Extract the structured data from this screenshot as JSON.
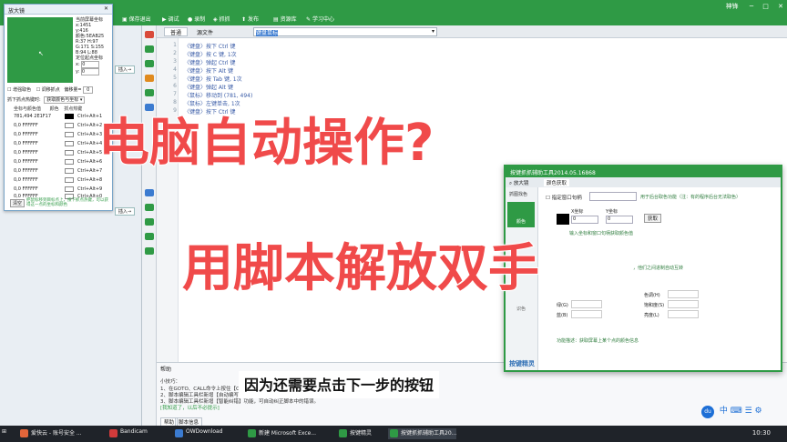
{
  "app": {
    "window_controls": "神锋",
    "toolbar": [
      {
        "label": "保存退出",
        "icon": "save-icon"
      },
      {
        "label": "调试",
        "icon": "debug-icon"
      },
      {
        "label": "录制",
        "icon": "record-icon"
      },
      {
        "label": "抓抓",
        "icon": "grab-icon"
      },
      {
        "label": "发布",
        "icon": "publish-icon"
      },
      {
        "label": "资源库",
        "icon": "library-icon"
      },
      {
        "label": "学习中心",
        "icon": "learn-icon"
      }
    ]
  },
  "editor": {
    "tab_label": "普通",
    "tab_source": "源文件",
    "input_value": "键盘鼠标",
    "lines": [
      "〈键盘〉按下 Ctrl 键",
      "〈键盘〉按 C 键, 1次",
      "〈键盘〉弹起 Ctrl 键",
      "〈键盘〉按下 Alt 键",
      "〈键盘〉按 Tab 键, 1次",
      "〈键盘〉弹起 Alt 键",
      "〈鼠标〉移动到 (781, 494)",
      "〈鼠标〉左键单击, 1次",
      "〈键盘〉按下 Ctrl 键"
    ]
  },
  "magnifier": {
    "title": "放大镜",
    "info": [
      "当前屏幕坐标",
      "x:1451",
      "y:416",
      "颜色:5EAB25",
      "R:37 H:97",
      "G:171 S:155",
      "B:94 L:88",
      "定位起点坐标",
      "x:",
      "y:"
    ],
    "x_value": "0",
    "y_value": "0",
    "options": [
      "增强取色",
      "调移抓点",
      "偏移量="
    ],
    "offset_value": "0",
    "hotkey_label": "抓下抓点热键时:",
    "hotkey_select": "获取颜色与坐标",
    "table_headers": [
      "坐标与颜色值",
      "颜色",
      "抓点热键"
    ],
    "rows": [
      {
        "coord": "781,494 2E1F17",
        "key": "Ctrl+Alt+1"
      },
      {
        "coord": "0,0 FFFFFF",
        "key": "Ctrl+Alt+2"
      },
      {
        "coord": "0,0 FFFFFF",
        "key": "Ctrl+Alt+3"
      },
      {
        "coord": "0,0 FFFFFF",
        "key": "Ctrl+Alt+4"
      },
      {
        "coord": "0,0 FFFFFF",
        "key": "Ctrl+Alt+5"
      },
      {
        "coord": "0,0 FFFFFF",
        "key": "Ctrl+Alt+6"
      },
      {
        "coord": "0,0 FFFFFF",
        "key": "Ctrl+Alt+7"
      },
      {
        "coord": "0,0 FFFFFF",
        "key": "Ctrl+Alt+8"
      },
      {
        "coord": "0,0 FFFFFF",
        "key": "Ctrl+Alt+9"
      },
      {
        "coord": "0,0 FFFFFF",
        "key": "Ctrl+Alt+0"
      }
    ],
    "clear_button": "清空",
    "hint": "把鼠标移到目标点上，按下抓点热键，可以获得这一点的坐标和颜色"
  },
  "picker": {
    "title": "按键抓抓辅助工具2014.05.16868",
    "tabs": [
      "放大镜",
      "颜色获取"
    ],
    "side_items": [
      "抓图找色",
      "颜色",
      "识色",
      "问答"
    ],
    "checkbox_label": "指定窗口句柄",
    "checkbox_hint": "用于后台取色功能（注：有的程序后台无法取色）",
    "x_label": "X坐标",
    "y_label": "Y坐标",
    "x_value": "0",
    "y_value": "0",
    "get_button": "获取",
    "instruction": "输入坐标和窗口句柄获取颜色值",
    "auto_note": "，他们之间进制自动互转",
    "labels": [
      "色调(H)",
      "饱和度(S)",
      "亮度(L)",
      "绿(G)",
      "蓝(B)"
    ],
    "description": "功能描述：获取屏幕上某个点的颜色信息",
    "brand": "按键精灵"
  },
  "help": {
    "title": "帮助",
    "tips_title": "小技巧：",
    "tips": [
      "1、在GOTO、CALL命令上按住【Ctrl】键，单击鼠标左键即可跳转到对应的标记",
      "2、脚本编辑工具栏新增【自动编写】功能",
      "3、脚本编辑工具栏新增【智能纠错】功能，可自动纠正脚本中的错误。"
    ],
    "tip_foot": "[我知道了，以后不必提示]",
    "tabs": [
      "帮助",
      "脚本信息"
    ]
  },
  "overlay": {
    "headline1": "电脑自动操作?",
    "headline2": "用脚本解放双手",
    "subtitle": "因为还需要点击下一步的按钮",
    "color": "#f04a4a"
  },
  "taskbar": {
    "items": [
      "爱快云 - 账号安全 ...",
      "Bandicam",
      "OWDownload",
      "新建 Microsoft Exce...",
      "按键精灵",
      "按键抓抓辅助工具20..."
    ],
    "ime_label": "中",
    "time": "10:30"
  }
}
